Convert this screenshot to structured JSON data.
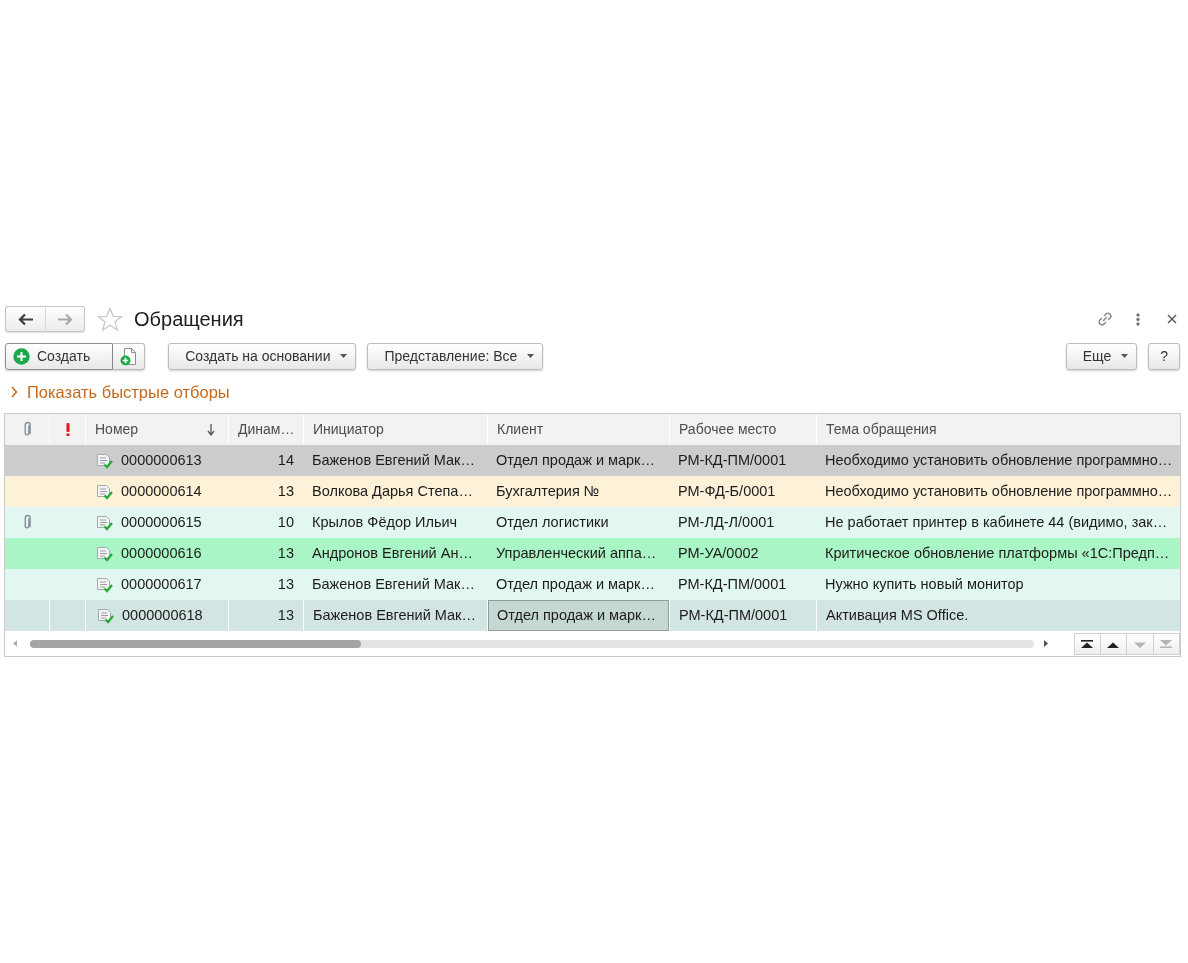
{
  "window": {
    "title": "Обращения",
    "favorite": false
  },
  "history_buttons": [
    {
      "kind": "back",
      "disabled": false
    },
    {
      "kind": "forward",
      "disabled": true
    }
  ],
  "toolbar": {
    "left": [
      [
        {
          "kind": "create",
          "label": "Создать"
        },
        {
          "kind": "document"
        }
      ],
      [
        {
          "kind": "menu",
          "label": "Создать на основании"
        }
      ],
      [
        {
          "kind": "menu",
          "label": "Представление: Все"
        }
      ]
    ],
    "right": [
      [
        {
          "kind": "menu",
          "label": "Еще"
        }
      ],
      [
        {
          "kind": "plain",
          "label": "?"
        }
      ]
    ]
  },
  "quick_filters": {
    "label": "Показать быстрые отборы",
    "expanded": false
  },
  "table": {
    "marker_columns": [
      {
        "kind": "attachment"
      },
      {
        "kind": "importance"
      }
    ],
    "columns": [
      {
        "kind": "document",
        "label": "Номер",
        "sorted": true,
        "focused": false
      },
      {
        "kind": "number",
        "label": "Динам…",
        "sorted": false,
        "focused": false
      },
      {
        "kind": "text",
        "label": "Инициатор",
        "sorted": false,
        "focused": false
      },
      {
        "kind": "text",
        "label": "Клиент",
        "sorted": false,
        "focused": true
      },
      {
        "kind": "text",
        "label": "Рабочее место",
        "sorted": false,
        "focused": false
      },
      {
        "kind": "text",
        "label": "Тема обращения",
        "sorted": false,
        "focused": false
      }
    ],
    "rows": [
      {
        "attachment": false,
        "color": "#cccccc",
        "selected": false,
        "cells": [
          "0000000613",
          "14",
          "Баженов Евгений Мак…",
          "Отдел продаж и марк…",
          "РМ-КД-ПМ/0001",
          "Необходимо установить обновление программно…"
        ]
      },
      {
        "attachment": false,
        "color": "#fdf2d8",
        "selected": false,
        "cells": [
          "0000000614",
          "13",
          "Волкова Дарья Степа…",
          "Бухгалтерия №",
          "РМ-ФД-Б/0001",
          "Необходимо установить обновление программно…"
        ]
      },
      {
        "attachment": true,
        "color": "#e2f6f2",
        "selected": false,
        "cells": [
          "0000000615",
          "10",
          "Крылов Фёдор Ильич",
          "Отдел логистики",
          "РМ-ЛД-Л/0001",
          "Не работает принтер в кабинете 44 (видимо, зак…"
        ]
      },
      {
        "attachment": false,
        "color": "#aaf5c5",
        "selected": false,
        "cells": [
          "0000000616",
          "13",
          "Андронов Евгений Ан…",
          "Управленческий аппа…",
          "РМ-УА/0002",
          "Критическое обновление платформы «1С:Предп…"
        ]
      },
      {
        "attachment": false,
        "color": "#e2f6f2",
        "selected": false,
        "cells": [
          "0000000617",
          "13",
          "Баженов Евгений Мак…",
          "Отдел продаж и марк…",
          "РМ-КД-ПМ/0001",
          "Нужно купить новый монитор"
        ]
      },
      {
        "attachment": false,
        "color": "#d3e5e2",
        "selected": true,
        "cells": [
          "0000000618",
          "13",
          "Баженов Евгений Мак…",
          "Отдел продаж и марк…",
          "РМ-КД-ПМ/0001",
          "Активация MS Office."
        ]
      }
    ],
    "navigation": [
      {
        "kind": "first",
        "disabled": false
      },
      {
        "kind": "up",
        "disabled": false
      },
      {
        "kind": "down",
        "disabled": true
      },
      {
        "kind": "last",
        "disabled": true
      }
    ]
  }
}
